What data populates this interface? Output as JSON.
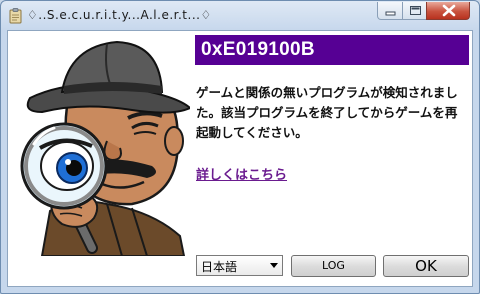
{
  "window": {
    "title": "♢..S.e.c.u.r.i.t.y...A.l.e.r.t...♢"
  },
  "dialog": {
    "error_code": "0xE019100B",
    "message": "ゲームと関係の無いプログラムが検知されました。該当プログラムを終了してからゲームを再起動してください。",
    "details_link": "詳しくはこちら",
    "banner_color": "#560094"
  },
  "footer": {
    "language_selected": "日本語",
    "log_button": "LOG",
    "ok_button": "OK"
  },
  "icons": {
    "title": "clipboard-icon",
    "illustration": "detective-magnifier-illustration"
  }
}
